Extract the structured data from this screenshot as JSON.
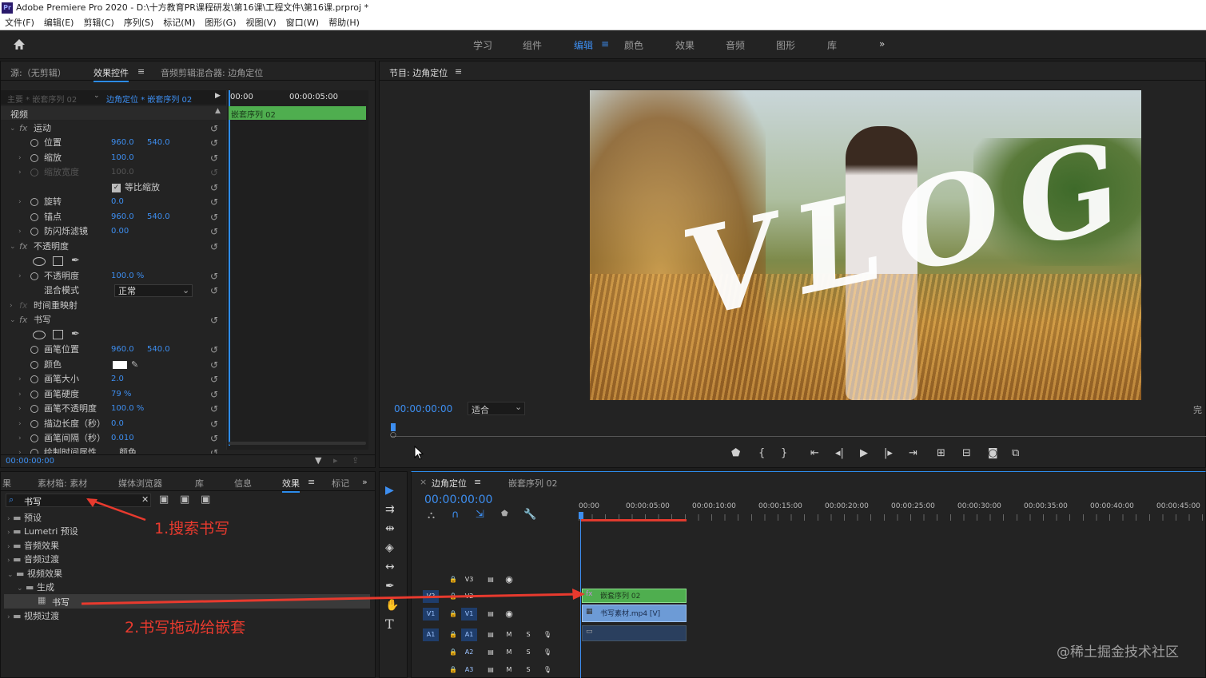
{
  "window": {
    "title": "Adobe Premiere Pro 2020 - D:\\十方教育PR课程研发\\第16课\\工程文件\\第16课.prproj *",
    "logo": "Pr"
  },
  "menu": [
    "文件(F)",
    "编辑(E)",
    "剪辑(C)",
    "序列(S)",
    "标记(M)",
    "图形(G)",
    "视图(V)",
    "窗口(W)",
    "帮助(H)"
  ],
  "workspaces": [
    "学习",
    "组件",
    "编辑",
    "颜色",
    "效果",
    "音频",
    "图形",
    "库"
  ],
  "workspace_active": "编辑",
  "workspace_more": "»",
  "source_panel": {
    "tab_source": "源:（无剪辑）",
    "tab_effect_controls": "效果控件",
    "tab_audio_mixer": "音频剪辑混合器: 边角定位",
    "master_label": "主要 * 嵌套序列 02",
    "clip_label": "边角定位 * 嵌套序列 02",
    "time_start": "00:00",
    "time_mid": "00:00:05:00",
    "clip_bar_label": "嵌套序列 02",
    "video_header": "视频",
    "bottom_time": "00:00:00:00",
    "properties": {
      "motion": "运动",
      "position": "位置",
      "position_x": "960.0",
      "position_y": "540.0",
      "scale": "缩放",
      "scale_val": "100.0",
      "scale_width": "缩放宽度",
      "scale_width_val": "100.0",
      "uniform_scale": "等比缩放",
      "rotation": "旋转",
      "rotation_val": "0.0",
      "anchor": "锚点",
      "anchor_x": "960.0",
      "anchor_y": "540.0",
      "flicker": "防闪烁滤镜",
      "flicker_val": "0.00",
      "opacity_group": "不透明度",
      "opacity": "不透明度",
      "opacity_val": "100.0 %",
      "blend_mode": "混合模式",
      "blend_mode_val": "正常",
      "time_remap": "时间重映射",
      "write": "书写",
      "brush_pos": "画笔位置",
      "brush_pos_x": "960.0",
      "brush_pos_y": "540.0",
      "color": "颜色",
      "brush_size": "画笔大小",
      "brush_size_val": "2.0",
      "brush_hardness": "画笔硬度",
      "brush_hardness_val": "79 %",
      "brush_opacity": "画笔不透明度",
      "brush_opacity_val": "100.0 %",
      "stroke_length": "描边长度（秒）",
      "stroke_length_val": "0.0",
      "brush_spacing": "画笔间隔（秒）",
      "brush_spacing_val": "0.010",
      "paint_time": "绘制时间属性",
      "paint_time_val": "颜色"
    }
  },
  "program_monitor": {
    "title": "节目: 边角定位",
    "timecode": "00:00:00:00",
    "fit": "适合",
    "right_label": "完",
    "vlog_text": "VLOG"
  },
  "project_panel": {
    "tabs": [
      "素材箱: 素材",
      "媒体浏览器",
      "库",
      "信息",
      "效果",
      "标记"
    ],
    "active_tab": "效果",
    "cut_tab": "果",
    "search_value": "书写",
    "tree": [
      "预设",
      "Lumetri 预设",
      "音频效果",
      "音频过渡",
      "视频效果",
      "生成",
      "书写",
      "视频过渡"
    ]
  },
  "timeline": {
    "tab_active": "边角定位",
    "tab_other": "嵌套序列 02",
    "timecode": "00:00:00:00",
    "ruler": [
      "00:00",
      "00:00:05:00",
      "00:00:10:00",
      "00:00:15:00",
      "00:00:20:00",
      "00:00:25:00",
      "00:00:30:00",
      "00:00:35:00",
      "00:00:40:00",
      "00:00:45:00"
    ],
    "video_tracks": [
      "V3",
      "V2",
      "V1"
    ],
    "audio_tracks": [
      "A1",
      "A2",
      "A3"
    ],
    "src_video": "V1",
    "src_audio": "A1",
    "clip_nested": "嵌套序列 02",
    "clip_video": "书写素材.mp4 [V]",
    "mute": "M",
    "solo": "S"
  },
  "annotations": {
    "step1": "1.搜索书写",
    "step2": "2.书写拖动给嵌套"
  },
  "watermark": "@稀土掘金技术社区",
  "colors": {
    "accent": "#2d8ceb",
    "clip_green": "#4fae4f",
    "clip_blue": "#6d9bd6",
    "annotation_red": "#e83a2e"
  }
}
